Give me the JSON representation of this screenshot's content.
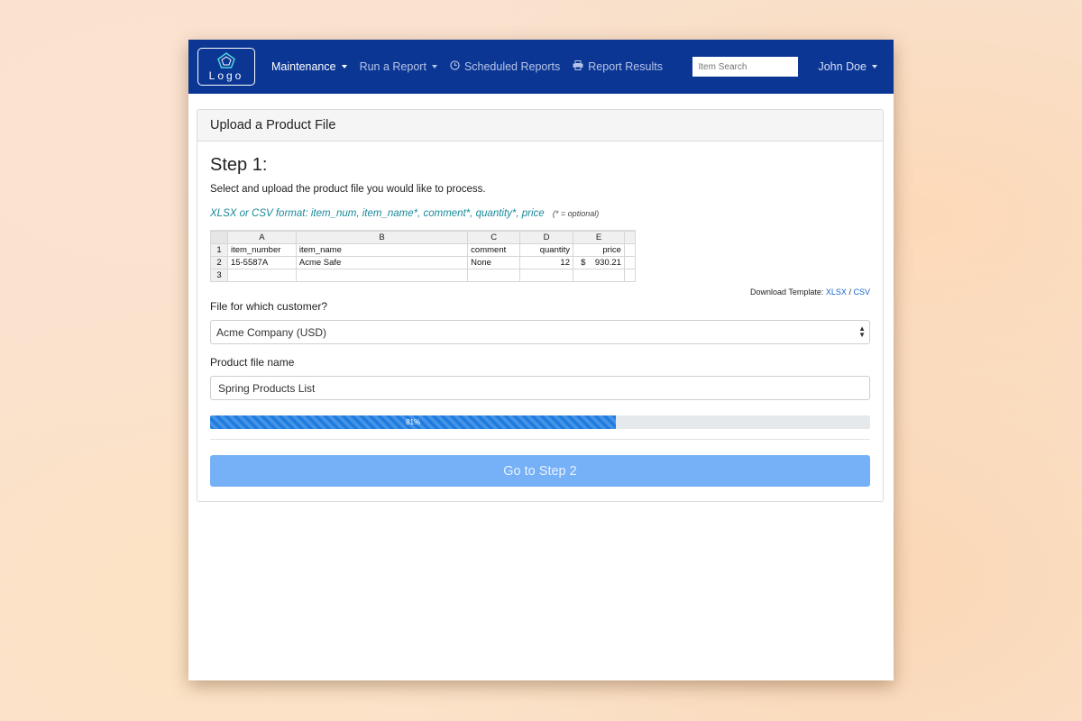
{
  "navbar": {
    "logo_text": "Logo",
    "items": [
      {
        "label": "Maintenance",
        "icon": "",
        "dropdown": true,
        "active": true
      },
      {
        "label": "Run a Report",
        "icon": "",
        "dropdown": true,
        "active": false
      },
      {
        "label": "Scheduled Reports",
        "icon": "clock-icon",
        "dropdown": false,
        "active": false
      },
      {
        "label": "Report Results",
        "icon": "printer-icon",
        "dropdown": false,
        "active": false
      }
    ],
    "search_placeholder": "Item Search",
    "user": "John Doe"
  },
  "card": {
    "header": "Upload a Product File",
    "step_title": "Step 1:",
    "step_desc": "Select and upload the product file you would like to process.",
    "format_text": "XLSX or CSV format: item_num, item_name*, comment*, quantity*, price",
    "optional_note": "(* = optional)",
    "sheet": {
      "columns": [
        "A",
        "B",
        "C",
        "D",
        "E"
      ],
      "rows": [
        {
          "n": "1",
          "cells": [
            "item_number",
            "item_name",
            "comment",
            "quantity",
            "price"
          ]
        },
        {
          "n": "2",
          "cells": [
            "15-5587A",
            "Acme Safe",
            "None",
            "12",
            "$    930.21"
          ]
        },
        {
          "n": "3",
          "cells": [
            "",
            "",
            "",
            "",
            ""
          ]
        }
      ]
    },
    "download_label": "Download Template:",
    "download_xlsx": "XLSX",
    "download_sep": "/",
    "download_csv": "CSV",
    "customer_label": "File for which customer?",
    "customer_value": "Acme Company (USD)",
    "filename_label": "Product file name",
    "filename_value": "Spring Products List",
    "progress_percent": 61.5,
    "progress_text": "81%",
    "button_label": "Go to Step 2"
  },
  "colors": {
    "navbar": "#0b3694",
    "accent": "#1e7ce0",
    "button": "#76b0f6",
    "format_text": "#1a8a9a"
  }
}
